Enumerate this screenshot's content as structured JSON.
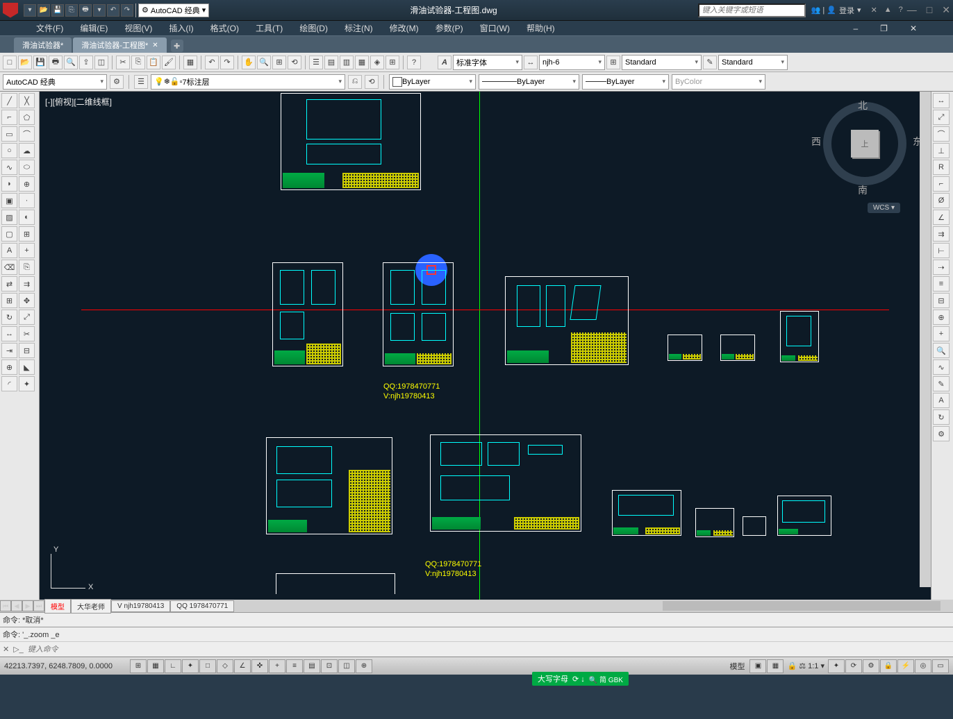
{
  "titlebar": {
    "workspace": "AutoCAD 经典",
    "title": "滑油试验器-工程图.dwg",
    "search_placeholder": "键入关键字或短语",
    "login": "登录"
  },
  "menus": [
    "文件(F)",
    "编辑(E)",
    "视图(V)",
    "插入(I)",
    "格式(O)",
    "工具(T)",
    "绘图(D)",
    "标注(N)",
    "修改(M)",
    "参数(P)",
    "窗口(W)",
    "帮助(H)"
  ],
  "doc_tabs": [
    {
      "label": "滑油试验器*",
      "active": false
    },
    {
      "label": "滑油试验器-工程图*",
      "active": true
    }
  ],
  "styles": {
    "textstyle": "标准字体",
    "dimstyle": "njh-6",
    "tablestyle": "Standard",
    "mlstyle": "Standard"
  },
  "panel": {
    "workspace": "AutoCAD 经典",
    "layer": "7标注层",
    "color": "ByLayer",
    "linetype": "ByLayer",
    "lineweight": "ByLayer",
    "plotstyle": "ByColor"
  },
  "viewport": {
    "label": "[-][俯视][二维线框]",
    "cube_top": "上",
    "north": "北",
    "south": "南",
    "east": "东",
    "west": "西",
    "wcs": "WCS ▾",
    "ucs_x": "X",
    "ucs_y": "Y"
  },
  "annotations": {
    "qq1": "QQ:1978470771",
    "v1": "V:njh19780413",
    "qq2": "QQ:1978470771",
    "v2": "V:njh19780413"
  },
  "layout_tabs": [
    "模型",
    "大华老师",
    "V  njh19780413",
    "QQ  1978470771"
  ],
  "cmd": {
    "line1": "命令:  *取消*",
    "line2": "命令: '_.zoom _e",
    "prompt": "键入命令"
  },
  "status": {
    "coords": "42213.7397, 6248.7809, 0.0000",
    "ime": "大写字母",
    "ime2": "简 GBK",
    "right_label": "模型",
    "scale": "1:1"
  }
}
